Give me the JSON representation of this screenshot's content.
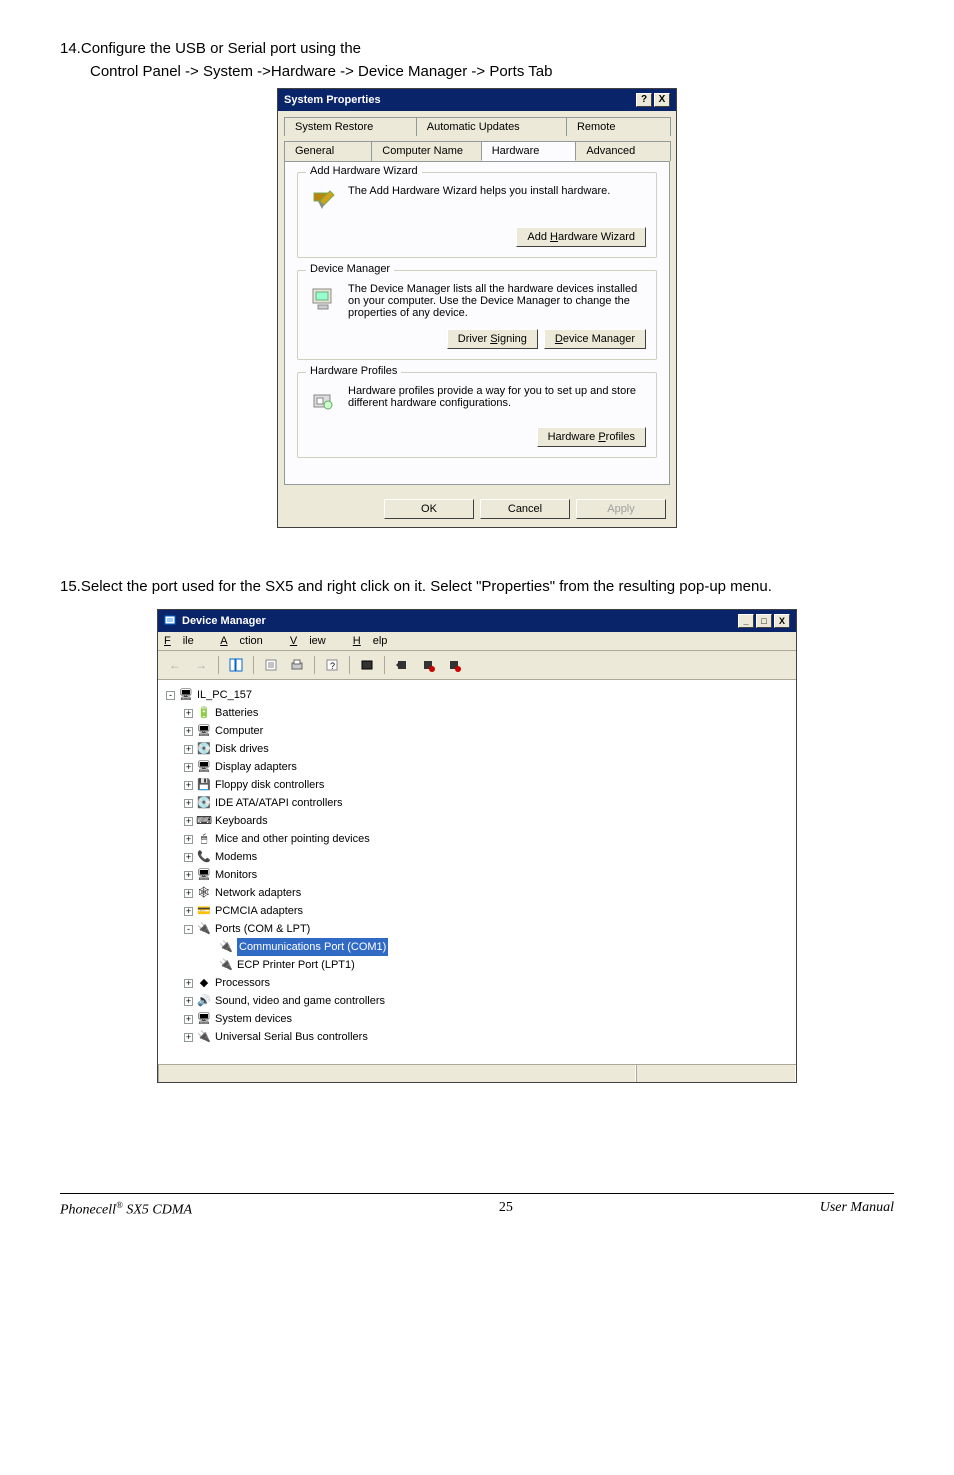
{
  "step14": {
    "num": "14.",
    "line1": "Configure the USB or Serial port using the",
    "line2": "Control Panel -> System ->Hardware -> Device Manager  -> Ports Tab"
  },
  "dialog": {
    "title": "System Properties",
    "help_btn": "?",
    "close_btn": "X",
    "tabs_row1": {
      "sr": "System Restore",
      "au": "Automatic Updates",
      "remote": "Remote"
    },
    "tabs_row2": {
      "general": "General",
      "cn": "Computer Name",
      "hardware": "Hardware",
      "advanced": "Advanced"
    },
    "grp_hw": {
      "title": "Add Hardware Wizard",
      "text": "The Add Hardware Wizard helps you install hardware.",
      "btn_prefix": "Add ",
      "btn_hot": "H",
      "btn_suffix": "ardware Wizard"
    },
    "grp_dm": {
      "title": "Device Manager",
      "text": "The Device Manager lists all the hardware devices installed on your computer. Use the Device Manager to change the properties of any device.",
      "btn1_prefix": "Driver ",
      "btn1_hot": "S",
      "btn1_suffix": "igning",
      "btn2_hot": "D",
      "btn2_suffix": "evice Manager"
    },
    "grp_hp": {
      "title": "Hardware Profiles",
      "text": "Hardware profiles provide a way for you to set up and store different hardware configurations.",
      "btn_prefix": "Hardware ",
      "btn_hot": "P",
      "btn_suffix": "rofiles"
    },
    "btn_ok": "OK",
    "btn_cancel": "Cancel",
    "btn_apply": "Apply"
  },
  "step15": {
    "num": "15.",
    "text": "Select the port used for the SX5 and right click on it. Select \"Properties\" from the resulting pop-up menu."
  },
  "dm": {
    "title": "Device Manager",
    "win_min": "_",
    "win_max": "□",
    "win_close": "X",
    "menu": {
      "f": "F",
      "file": "ile",
      "a": "A",
      "action": "ction",
      "v": "V",
      "view": "iew",
      "h": "H",
      "help": "elp"
    },
    "root": "IL_PC_157",
    "items": [
      "Batteries",
      "Computer",
      "Disk drives",
      "Display adapters",
      "Floppy disk controllers",
      "IDE ATA/ATAPI controllers",
      "Keyboards",
      "Mice and other pointing devices",
      "Modems",
      "Monitors",
      "Network adapters",
      "PCMCIA adapters"
    ],
    "ports": "Ports (COM & LPT)",
    "com1": "Communications Port (COM1)",
    "lpt1": "ECP Printer Port (LPT1)",
    "after": [
      "Processors",
      "Sound, video and game controllers",
      "System devices",
      "Universal Serial Bus controllers"
    ]
  },
  "footer": {
    "left_prefix": "Phonecell",
    "left_reg": "®",
    "left_suffix": " SX5 CDMA",
    "page": "25",
    "right": "User Manual"
  }
}
